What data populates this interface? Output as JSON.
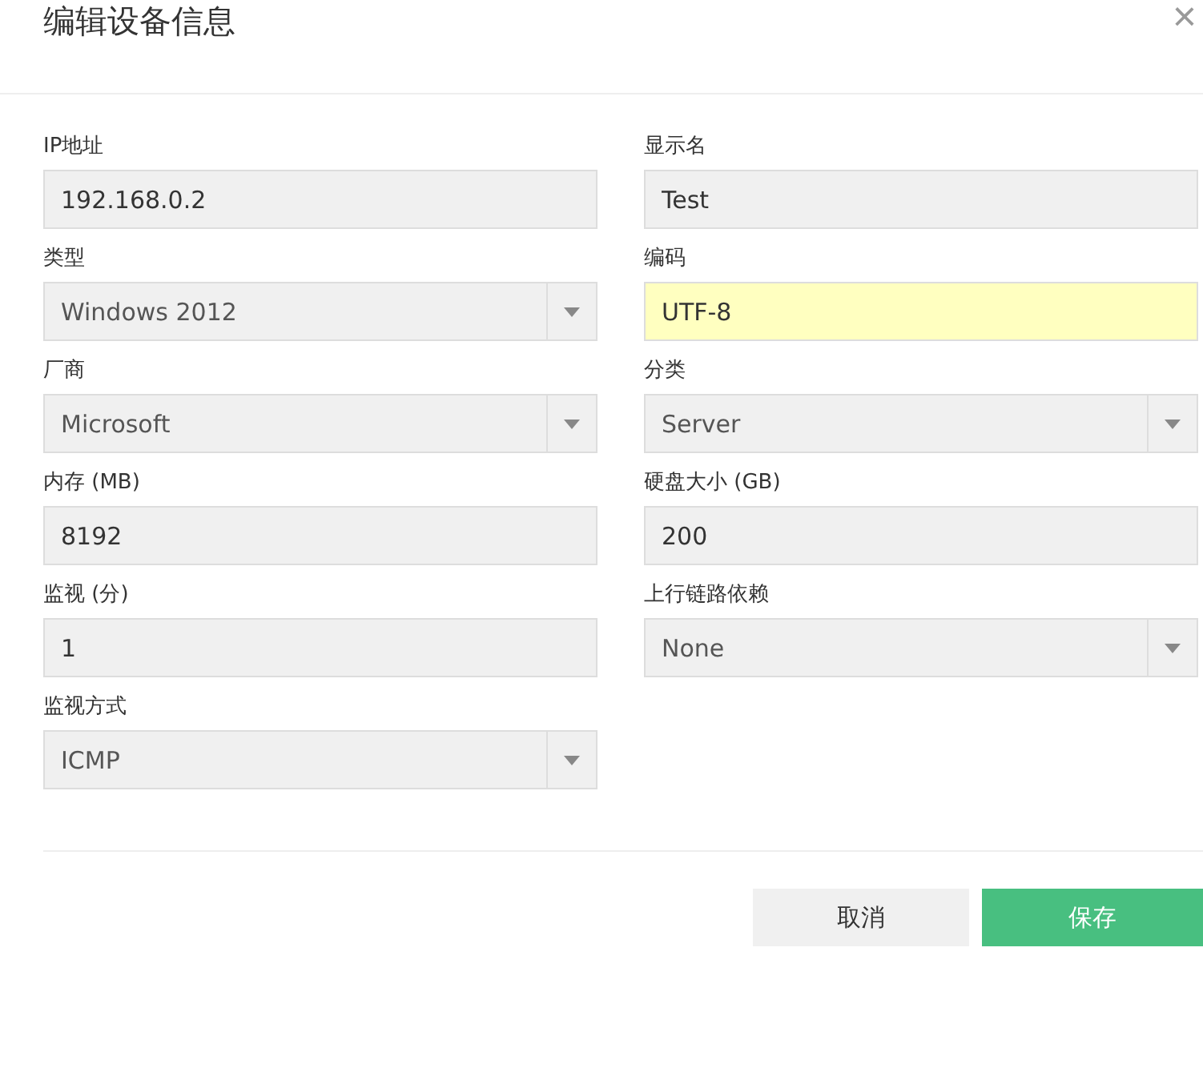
{
  "dialog": {
    "title": "编辑设备信息",
    "close": "×"
  },
  "fields": [
    {
      "label": "IP地址",
      "kind": "text",
      "value": "192.168.0.2",
      "highlighted": false
    },
    {
      "label": "显示名",
      "kind": "text",
      "value": "Test",
      "highlighted": false
    },
    {
      "label": "类型",
      "kind": "select",
      "value": "Windows 2012",
      "highlighted": false
    },
    {
      "label": "编码",
      "kind": "text",
      "value": "UTF-8",
      "highlighted": true
    },
    {
      "label": "厂商",
      "kind": "select",
      "value": "Microsoft",
      "highlighted": false
    },
    {
      "label": "分类",
      "kind": "select",
      "value": "Server",
      "highlighted": false
    },
    {
      "label": "内存 (MB)",
      "kind": "text",
      "value": "8192",
      "highlighted": false
    },
    {
      "label": "硬盘大小 (GB)",
      "kind": "text",
      "value": "200",
      "highlighted": false
    },
    {
      "label": "监视 (分)",
      "kind": "text",
      "value": "1",
      "highlighted": false
    },
    {
      "label": "上行链路依赖",
      "kind": "select",
      "value": "None",
      "highlighted": false
    },
    {
      "label": "监视方式",
      "kind": "select",
      "value": "ICMP",
      "highlighted": false
    }
  ],
  "buttons": [
    {
      "label": "取消",
      "kind": "secondary"
    },
    {
      "label": "保存",
      "kind": "primary"
    }
  ]
}
